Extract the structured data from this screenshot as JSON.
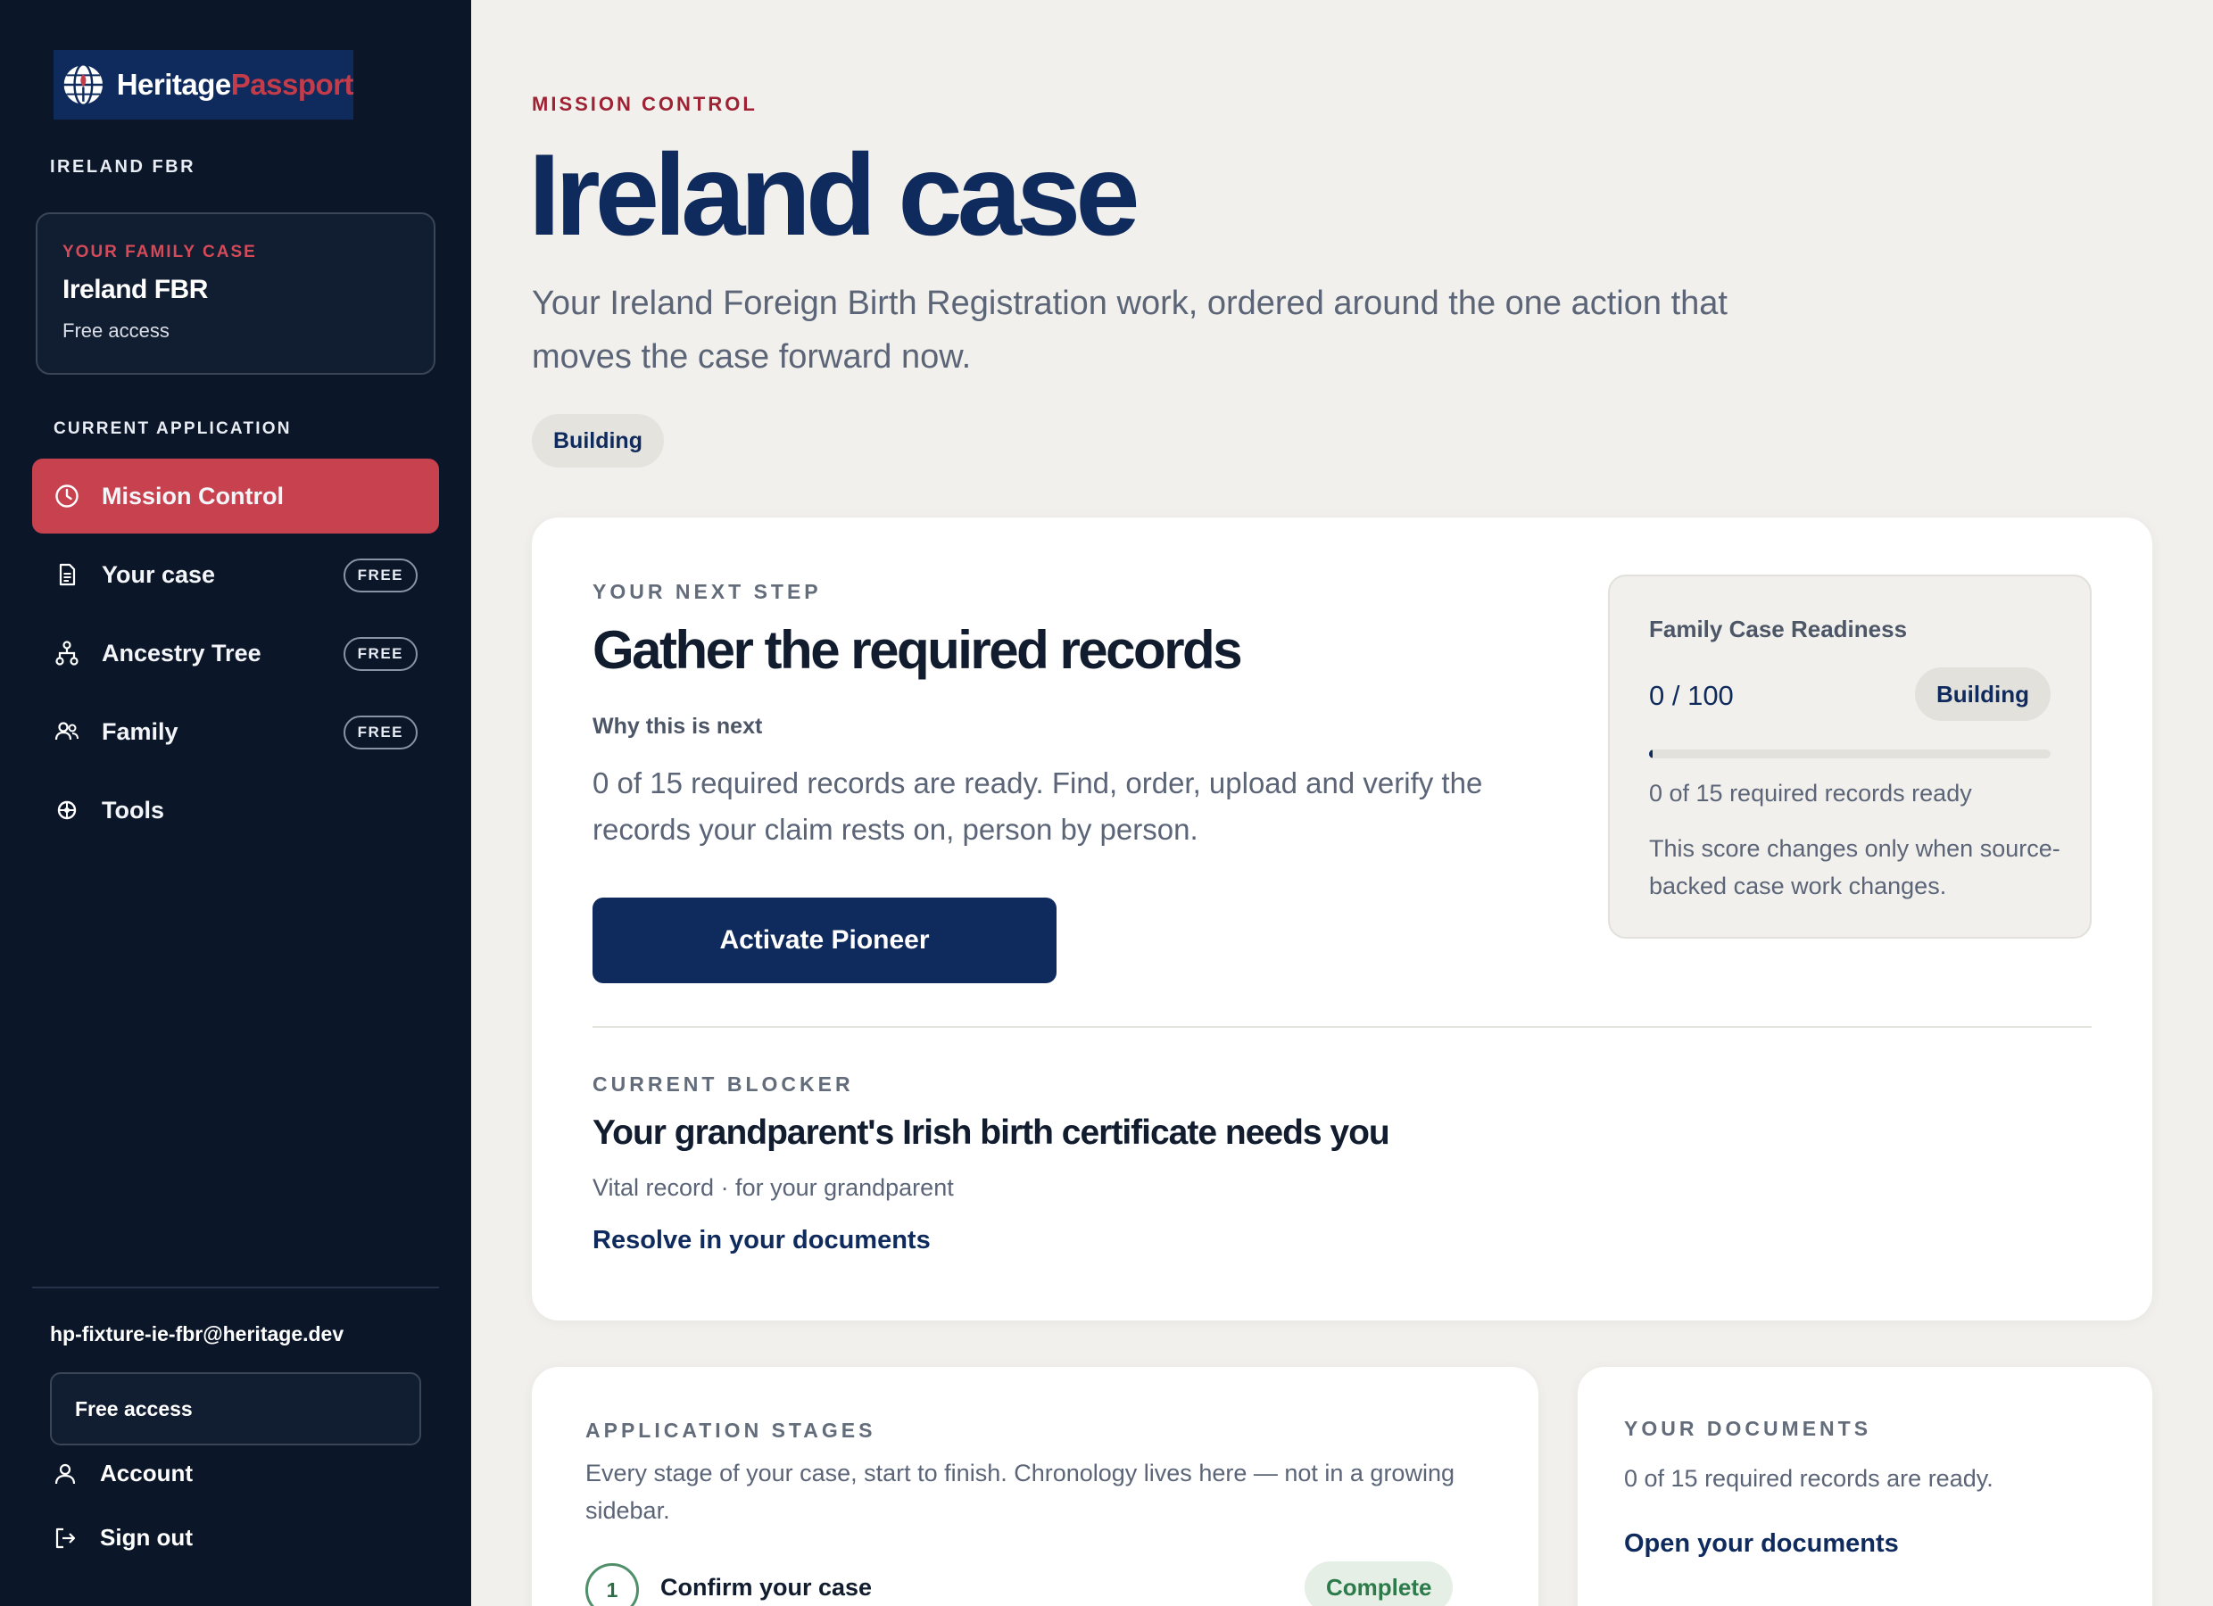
{
  "sidebar": {
    "logo": {
      "word1": "Heritage",
      "word2": "Passport"
    },
    "country_label": "IRELAND FBR",
    "case_card": {
      "eyebrow": "YOUR FAMILY CASE",
      "title": "Ireland FBR",
      "subtitle": "Free access"
    },
    "section_label": "CURRENT APPLICATION",
    "nav": [
      {
        "label": "Mission Control",
        "badge": "",
        "icon": "clock-icon",
        "active": true
      },
      {
        "label": "Your case",
        "badge": "FREE",
        "icon": "document-icon",
        "active": false
      },
      {
        "label": "Ancestry Tree",
        "badge": "FREE",
        "icon": "tree-icon",
        "active": false
      },
      {
        "label": "Family",
        "badge": "FREE",
        "icon": "people-icon",
        "active": false
      },
      {
        "label": "Tools",
        "badge": "",
        "icon": "tools-icon",
        "active": false
      }
    ],
    "user_email": "hp-fixture-ie-fbr@heritage.dev",
    "plan_label": "Free access",
    "account_label": "Account",
    "signout_label": "Sign out"
  },
  "header": {
    "eyebrow": "MISSION CONTROL",
    "title": "Ireland case",
    "description": "Your Ireland Foreign Birth Registration work, ordered around the one action that moves the case forward now.",
    "status_chip": "Building"
  },
  "next_step": {
    "eyebrow": "YOUR NEXT STEP",
    "title": "Gather the required records",
    "why_label": "Why this is next",
    "why_text": "0 of 15 required records are ready. Find, order, upload and verify the records your claim rests on, person by person.",
    "button_label": "Activate Pioneer"
  },
  "readiness": {
    "title": "Family Case Readiness",
    "score": "0 / 100",
    "score_value": 0,
    "score_max": 100,
    "status": "Building",
    "records_line": "0 of 15 required records ready",
    "note": "This score changes only when source-backed case work changes."
  },
  "blocker": {
    "eyebrow": "CURRENT BLOCKER",
    "title": "Your grandparent's Irish birth certificate needs you",
    "meta": "Vital record · for your grandparent",
    "link": "Resolve in your documents"
  },
  "stages": {
    "eyebrow": "APPLICATION STAGES",
    "description": "Every stage of your case, start to finish. Chronology lives here — not in a growing sidebar.",
    "items": [
      {
        "number": "1",
        "name": "Confirm your case",
        "status": "Complete"
      }
    ]
  },
  "documents": {
    "eyebrow": "YOUR DOCUMENTS",
    "text": "0 of 15 required records are ready.",
    "link": "Open your documents"
  },
  "colors": {
    "navy": "#0f2a5c",
    "sidebar_bg": "#0b1629",
    "accent_red": "#c8414e",
    "eyebrow_red": "#9e2233",
    "page_bg": "#f1f0ec",
    "complete_green": "#2d7a4a"
  }
}
